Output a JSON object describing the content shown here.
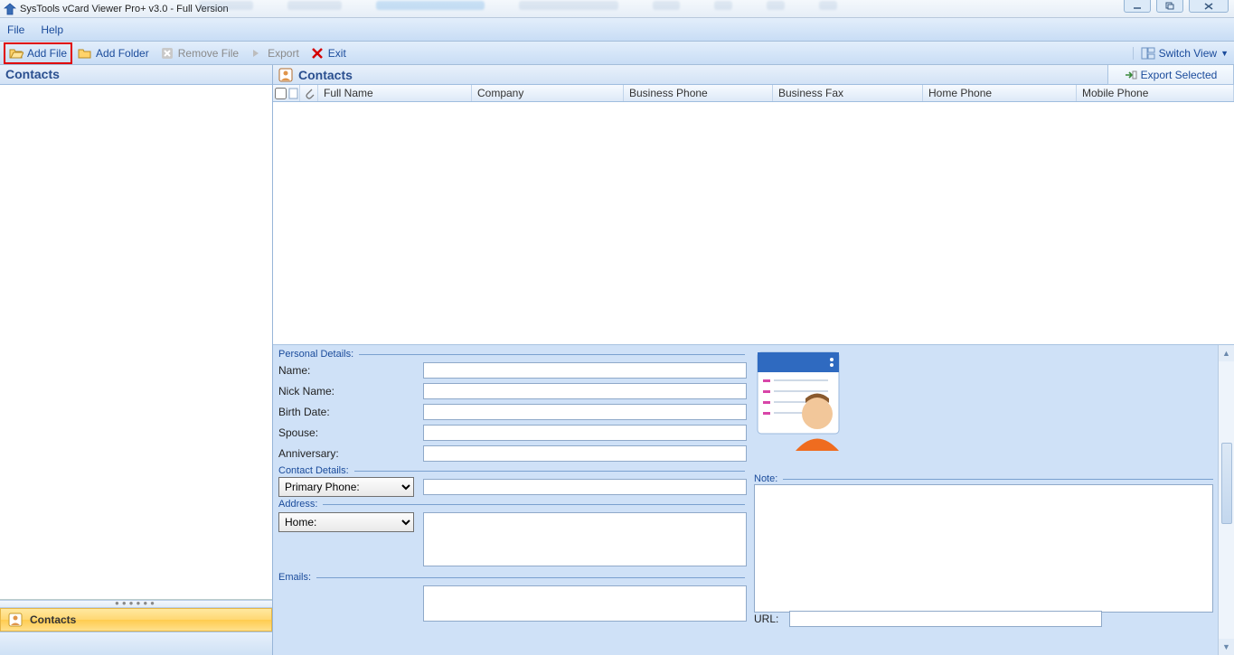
{
  "title": "SysTools vCard Viewer Pro+ v3.0 - Full Version",
  "menubar": {
    "file": "File",
    "help": "Help"
  },
  "toolbar": {
    "add_file": "Add File",
    "add_folder": "Add Folder",
    "remove_file": "Remove File",
    "export": "Export",
    "exit": "Exit",
    "switch_view": "Switch View"
  },
  "left": {
    "header": "Contacts",
    "nav_contacts": "Contacts"
  },
  "right": {
    "header": "Contacts",
    "export_selected": "Export Selected",
    "columns": {
      "full_name": "Full Name",
      "company": "Company",
      "business_phone": "Business Phone",
      "business_fax": "Business Fax",
      "home_phone": "Home Phone",
      "mobile_phone": "Mobile Phone"
    }
  },
  "details": {
    "personal": {
      "legend": "Personal Details:",
      "name": "Name:",
      "nick": "Nick Name:",
      "birth": "Birth Date:",
      "spouse": "Spouse:",
      "anniv": "Anniversary:"
    },
    "contact": {
      "legend": "Contact Details:",
      "primary_phone": "Primary Phone:"
    },
    "address": {
      "legend": "Address:",
      "home": "Home:"
    },
    "emails": {
      "legend": "Emails:"
    },
    "note": {
      "legend": "Note:"
    },
    "url": {
      "legend": "URL:"
    }
  },
  "values": {
    "name": "",
    "nick": "",
    "birth": "",
    "spouse": "",
    "anniv": "",
    "primary_phone": "",
    "address_text": "",
    "emails_text": "",
    "note_text": "",
    "url_text": ""
  }
}
